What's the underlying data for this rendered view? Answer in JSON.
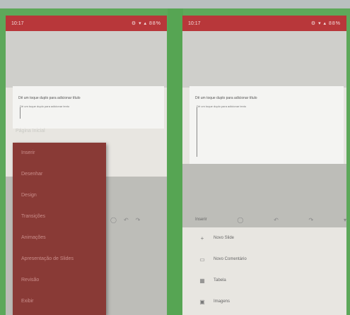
{
  "left_phone": {
    "status_time": "10:17",
    "status_icons": "⚙ ▾ ▴ 88%",
    "slide_title": "Dê um toque duplo para adicionar título",
    "slide_subtitle": "Dê um toque duplo para adicionar texto",
    "heading": "Página Inicial",
    "menu_items": [
      "Inserir",
      "Desenhar",
      "Design",
      "Transições",
      "Animações",
      "Apresentação de Slides",
      "Revisão",
      "Exibir"
    ]
  },
  "right_phone": {
    "status_time": "10:17",
    "status_icons": "⚙ ▾ ▴ 88%",
    "slide_title": "Dê um toque duplo para adicionar título",
    "slide_subtitle": "Dê um toque duplo para adicionar texto",
    "toolbar_label": "Inserir",
    "list_items": [
      {
        "icon": "plus-icon",
        "label": "Novo Slide"
      },
      {
        "icon": "comment-icon",
        "label": "Novo Comentário"
      },
      {
        "icon": "table-icon",
        "label": "Tabela"
      },
      {
        "icon": "image-icon",
        "label": "Imagens"
      }
    ]
  },
  "colors": {
    "status_bar": "#b8373a",
    "menu_background": "#893a36",
    "frame_green": "#5da85a"
  }
}
